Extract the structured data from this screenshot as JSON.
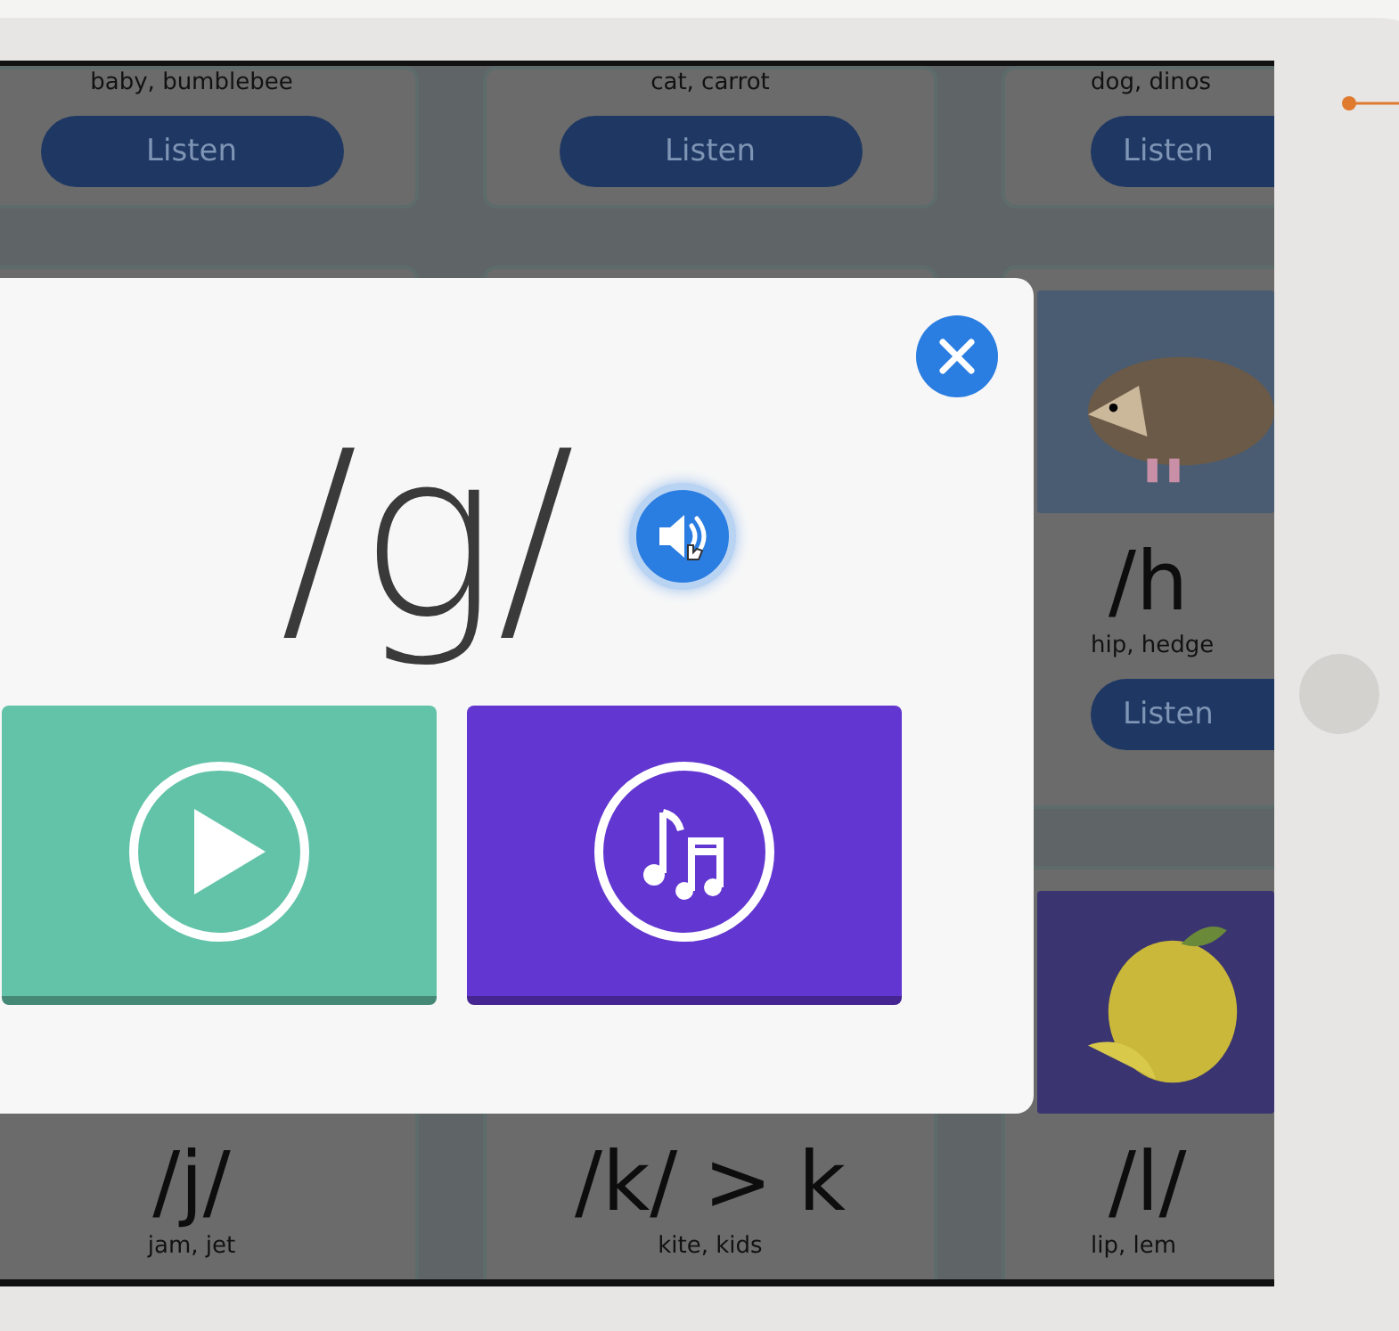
{
  "rows": [
    [
      {
        "caption": "baby, bumblebee",
        "button": "Listen"
      },
      {
        "caption": "cat, carrot",
        "button": "Listen"
      },
      {
        "caption": "dog, dinos",
        "button": "Listen"
      }
    ],
    [
      {},
      {},
      {
        "image": true,
        "color": "#4a5c72",
        "sound": "/h",
        "caption": "hip, hedge",
        "button": "Listen"
      }
    ],
    [
      {
        "sound": "/j/",
        "caption": "jam, jet"
      },
      {
        "sound": "/k/ > k",
        "caption": "kite, kids"
      },
      {
        "image": true,
        "color": "#3a3470",
        "sound": "/l/",
        "caption": "lip, lem"
      }
    ]
  ],
  "modal": {
    "sound": "/g/",
    "buttons": [
      {
        "kind": "play",
        "color": "#62c3a8"
      },
      {
        "kind": "music",
        "color": "#6236d0"
      }
    ]
  }
}
